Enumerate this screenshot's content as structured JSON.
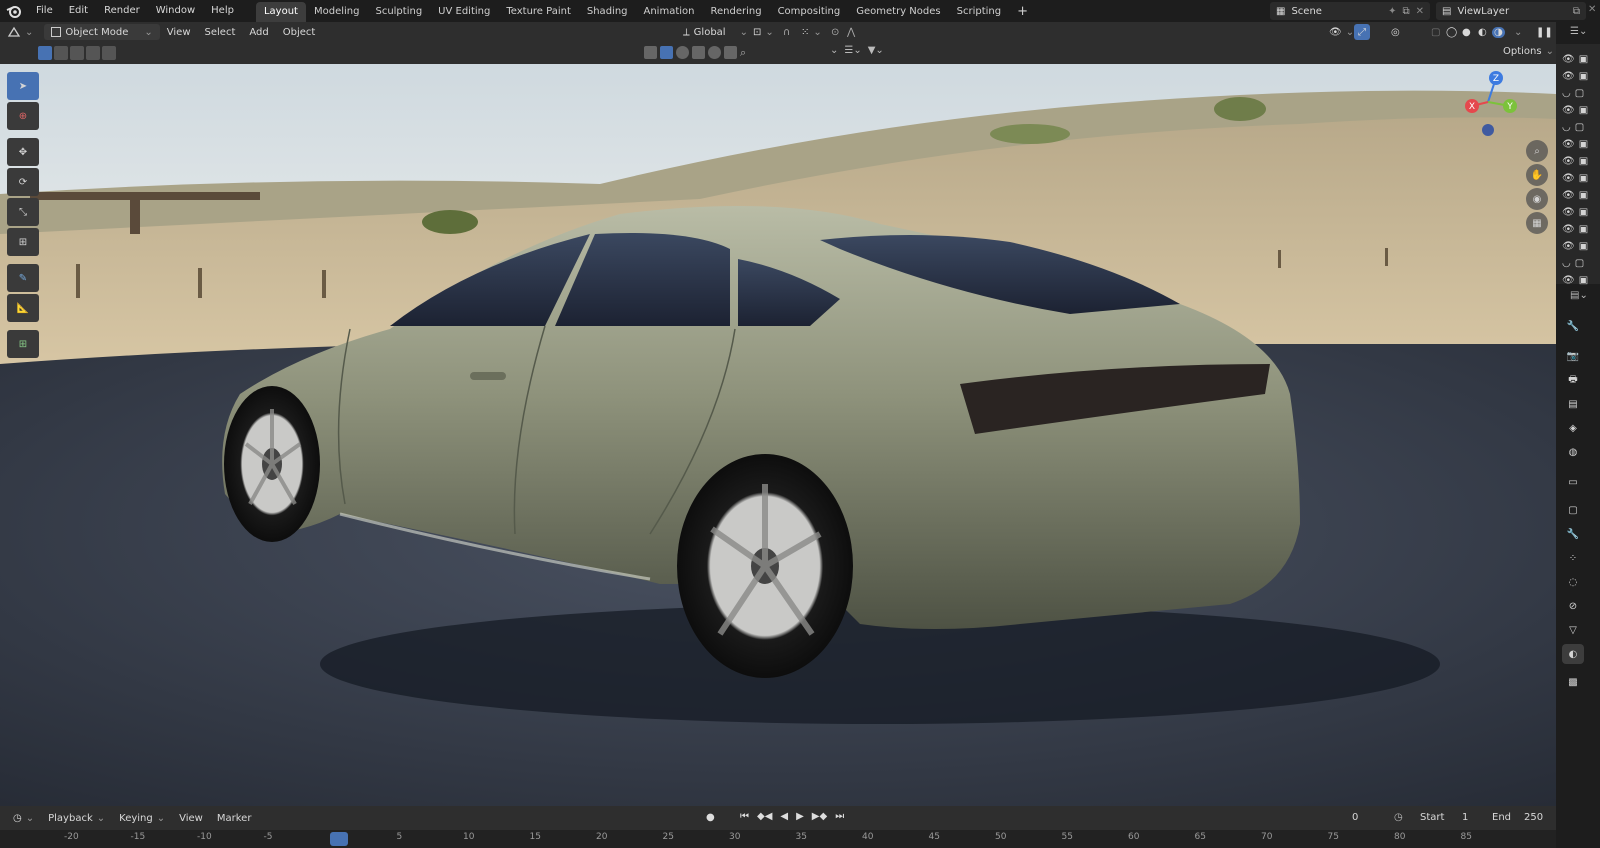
{
  "topbar": {
    "menus": [
      "File",
      "Edit",
      "Render",
      "Window",
      "Help"
    ],
    "workspaces": [
      {
        "label": "Layout",
        "active": true
      },
      {
        "label": "Modeling",
        "active": false
      },
      {
        "label": "Sculpting",
        "active": false
      },
      {
        "label": "UV Editing",
        "active": false
      },
      {
        "label": "Texture Paint",
        "active": false
      },
      {
        "label": "Shading",
        "active": false
      },
      {
        "label": "Animation",
        "active": false
      },
      {
        "label": "Rendering",
        "active": false
      },
      {
        "label": "Compositing",
        "active": false
      },
      {
        "label": "Geometry Nodes",
        "active": false
      },
      {
        "label": "Scripting",
        "active": false
      }
    ],
    "add_workspace": "+",
    "scene_name": "Scene",
    "view_layer": "ViewLayer"
  },
  "header": {
    "mode": "Object Mode",
    "menus": [
      "View",
      "Select",
      "Add",
      "Object"
    ],
    "transform_orientation": "Global",
    "options": "Options"
  },
  "timeline": {
    "menus": [
      "Playback",
      "Keying",
      "View",
      "Marker"
    ],
    "current_frame": "0",
    "start_label": "Start",
    "start": "1",
    "end_label": "End",
    "end": "250",
    "ruler_labels": [
      "-20",
      "-15",
      "-10",
      "-5",
      "0",
      "5",
      "10",
      "15",
      "20",
      "25",
      "30",
      "35",
      "40",
      "45",
      "50",
      "55",
      "60",
      "65",
      "70",
      "75",
      "80",
      "85"
    ]
  },
  "gizmo": {
    "x": "X",
    "y": "Y",
    "z": "Z"
  },
  "colors": {
    "accent": "#4772b3",
    "car_body": "#8c9079",
    "ground": "#3a4150",
    "sky": "#dfe6ea",
    "axis_x": "#e5484d",
    "axis_y": "#7cc23b",
    "axis_z": "#3d7be0"
  }
}
